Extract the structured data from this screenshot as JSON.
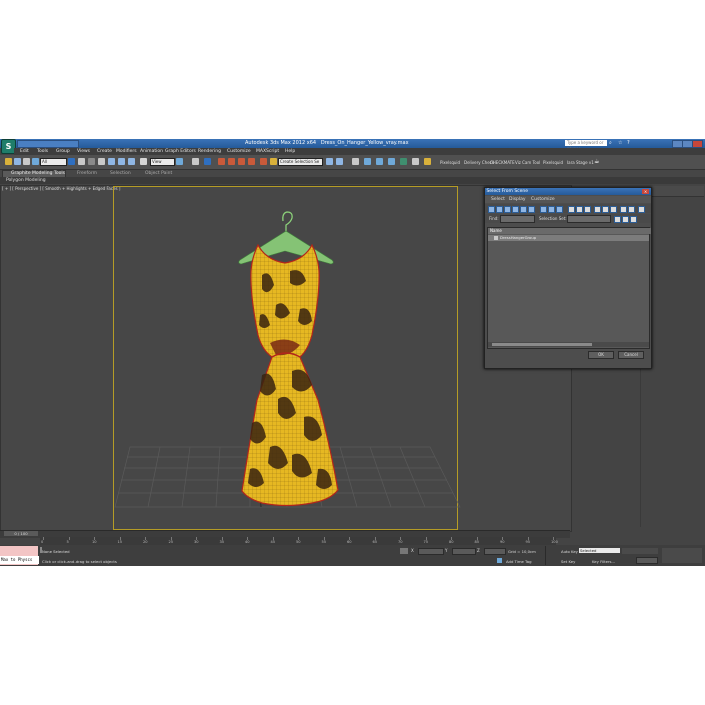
{
  "title_bar": {
    "app_title": "Autodesk 3ds Max 2012 x64",
    "file_name": "Dress_On_Hanger_Yellow_vray.max",
    "search_placeholder": "Type a keyword or phrase"
  },
  "menu_bar": {
    "items": [
      "Edit",
      "Tools",
      "Group",
      "Views",
      "Create",
      "Modifiers",
      "Animation",
      "Graph Editors",
      "Rendering",
      "Customize",
      "MAXScript",
      "Help"
    ]
  },
  "toolbar": {
    "selection_filter": "All",
    "reference_coord": "View",
    "named_selection": "Create Selection Se",
    "plugins": [
      "Pixelsquid",
      "Delivery Check",
      "CHECKMATE",
      "Viz Cam Tool",
      "Pixelsquid",
      "Iara Stage v1"
    ]
  },
  "ribbon": {
    "tabs": [
      "Graphite Modeling Tools",
      "Freeform",
      "Selection",
      "Object Paint"
    ],
    "sub_label": "Polygon Modeling"
  },
  "viewport": {
    "label": "[ + ] [ Perspective ] [ Smooth + Highlights + Edged Faces ]"
  },
  "timeline": {
    "frame_counter": "0 / 100",
    "ticks": [
      "0",
      "5",
      "10",
      "15",
      "20",
      "25",
      "30",
      "35",
      "40",
      "45",
      "50",
      "55",
      "60",
      "65",
      "70",
      "75",
      "80",
      "85",
      "90",
      "95",
      "100"
    ]
  },
  "status": {
    "maxscript_label": "Max to Physcs",
    "selection_status": "None Selected",
    "prompt": "Click or click-and-drag to select objects",
    "grid_label": "Grid = 10,0cm",
    "add_time_tag": "Add Time Tag",
    "auto_key": "Auto Key",
    "auto_key_mode": "Selected",
    "set_key": "Set Key",
    "key_filters": "Key Filters..."
  },
  "select_dialog": {
    "title": "Select From Scene",
    "menu": [
      "Select",
      "Display",
      "Customize"
    ],
    "find_label": "Find:",
    "selection_set_label": "Selection Set:",
    "list_header": "Name",
    "list_items": [
      "DressHangerGroup"
    ],
    "ok_label": "OK",
    "cancel_label": "Cancel"
  },
  "colors": {
    "title_bar": "#2f67aa",
    "viewport_bg": "#474747",
    "safe_frame": "#b59c26",
    "dress_fill": "#e6b822",
    "dress_pattern": "#3a2410",
    "wire_red": "#b2261b",
    "hanger_green": "#8cd17a"
  }
}
